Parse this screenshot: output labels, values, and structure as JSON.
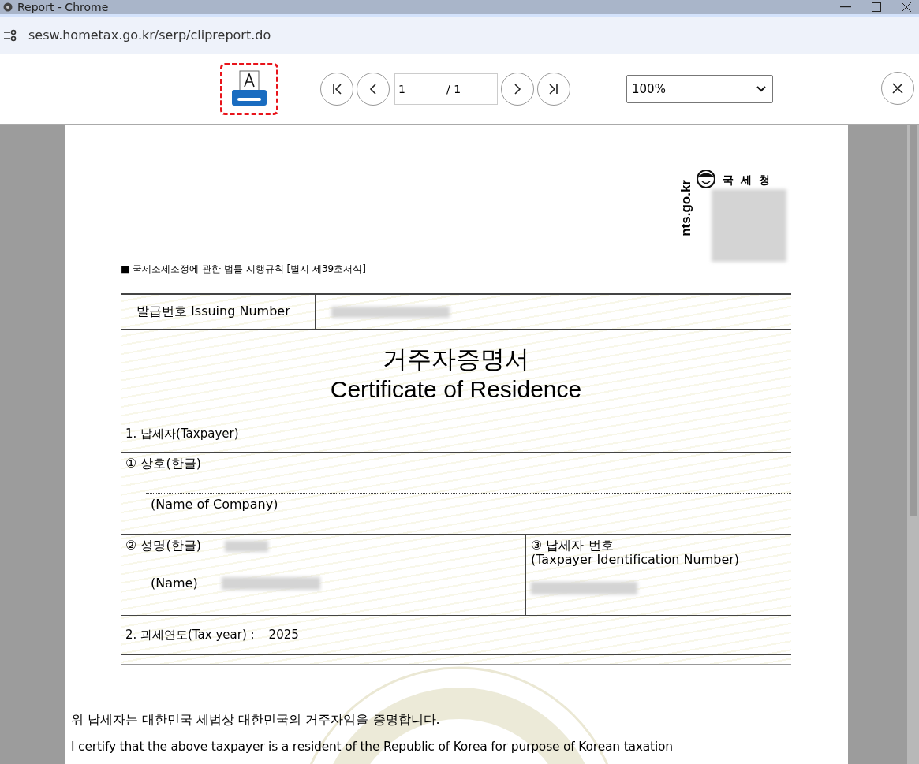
{
  "window": {
    "title": "Report - Chrome"
  },
  "address_bar": {
    "url": "sesw.hometax.go.kr/serp/clipreport.do"
  },
  "toolbar": {
    "page_input": "1",
    "page_total": "/ 1",
    "zoom": "100%"
  },
  "document": {
    "logo_text": "국 세 청",
    "logo_url": "nts.go.kr",
    "form_reference": "■ 국제조세조정에 관한 법률 시행규칙 [별지 제39호서식]",
    "issuing_label": "발급번호 Issuing Number",
    "title_ko": "거주자증명서",
    "title_en": "Certificate of Residence",
    "section_1": "1. 납세자(Taxpayer)",
    "company_label": "①  상호(한글)",
    "company_label_en": "(Name of Company)",
    "name_label": "②  성명(한글)",
    "name_label_en": "(Name)",
    "tin_label": "③ 납세자 번호",
    "tin_label_en": "(Taxpayer Identification Number)",
    "section_2": "2. 과세연도(Tax year) :",
    "tax_year": "2025",
    "statement_ko": "위 납세자는 대한민국 세법상 대한민국의 거주자임을 증명합니다.",
    "statement_en": "I certify that the above taxpayer is a resident of the Republic of Korea for purpose of Korean taxation"
  }
}
